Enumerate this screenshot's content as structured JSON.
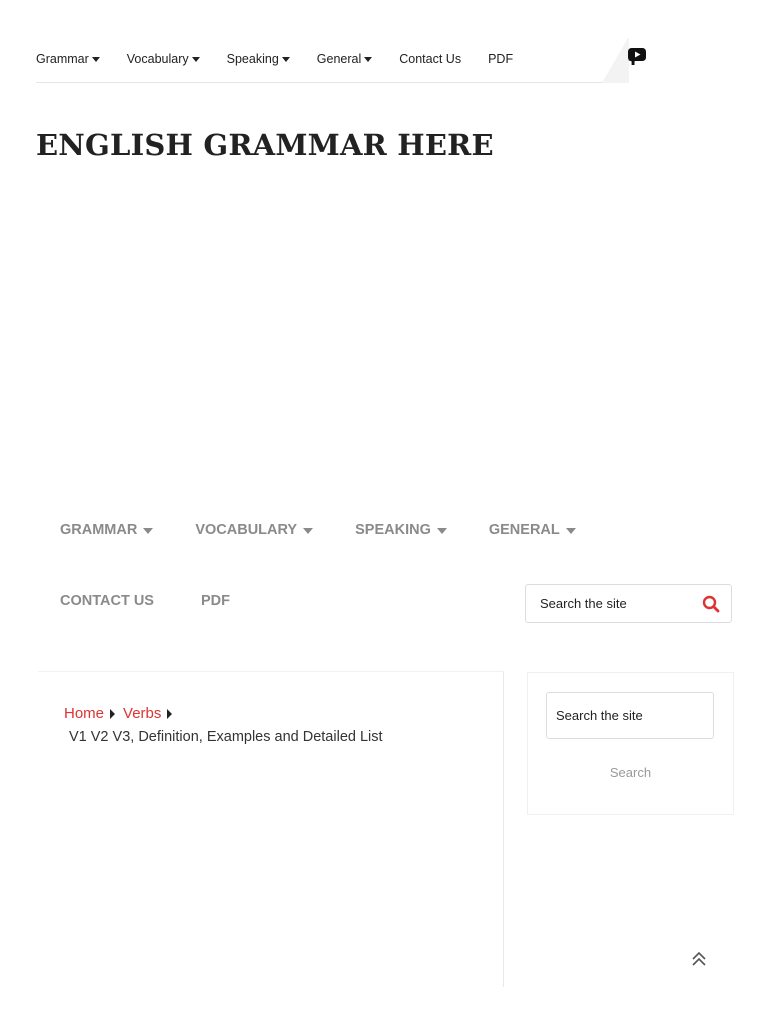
{
  "topbar": {
    "items": [
      {
        "label": "Grammar",
        "dropdown": true
      },
      {
        "label": "Vocabulary",
        "dropdown": true
      },
      {
        "label": "Speaking",
        "dropdown": true
      },
      {
        "label": "General",
        "dropdown": true
      },
      {
        "label": "Contact Us",
        "dropdown": false
      },
      {
        "label": "PDF",
        "dropdown": false
      }
    ],
    "social": [
      "facebook-icon",
      "twitter-icon",
      "youtube-icon"
    ]
  },
  "site": {
    "title": "ENGLISH GRAMMAR HERE"
  },
  "mainnav": {
    "row1": [
      {
        "label": "GRAMMAR",
        "dropdown": true
      },
      {
        "label": "VOCABULARY",
        "dropdown": true
      },
      {
        "label": "SPEAKING",
        "dropdown": true
      },
      {
        "label": "GENERAL",
        "dropdown": true
      }
    ],
    "row2": [
      {
        "label": "CONTACT US"
      },
      {
        "label": "PDF"
      }
    ],
    "search_placeholder": "Search the site"
  },
  "breadcrumb": {
    "home": "Home",
    "category": "Verbs",
    "current": "V1 V2 V3, Definition, Examples and Detailed List"
  },
  "sidebar": {
    "search_placeholder": "Search the site",
    "search_button": "Search"
  },
  "colors": {
    "accent": "#dd3333",
    "nav_gray": "#8a8a8a"
  }
}
